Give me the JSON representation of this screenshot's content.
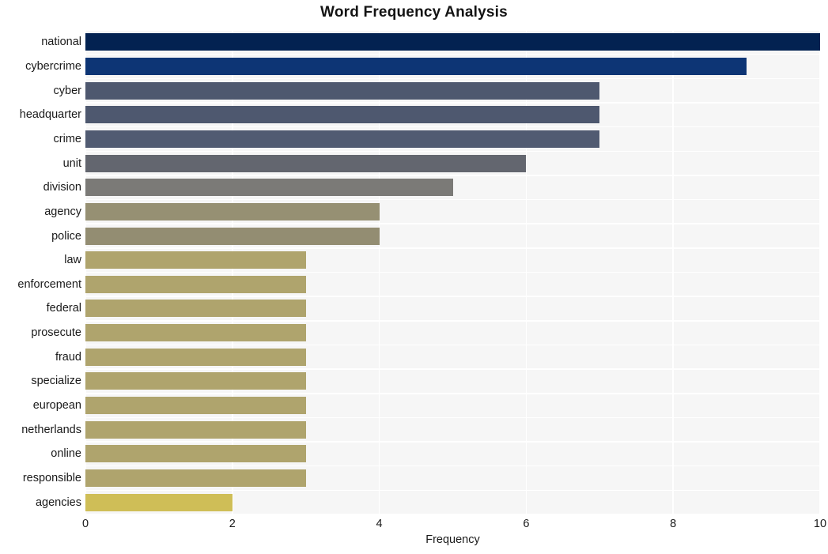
{
  "chart_data": {
    "type": "bar",
    "orientation": "horizontal",
    "title": "Word Frequency Analysis",
    "xlabel": "Frequency",
    "ylabel": "",
    "xlim": [
      0,
      10
    ],
    "xticks": [
      0,
      2,
      4,
      6,
      8,
      10
    ],
    "grid": true,
    "legend": null,
    "categories": [
      "national",
      "cybercrime",
      "cyber",
      "headquarter",
      "crime",
      "unit",
      "division",
      "agency",
      "police",
      "law",
      "enforcement",
      "federal",
      "prosecute",
      "fraud",
      "specialize",
      "european",
      "netherlands",
      "online",
      "responsible",
      "agencies"
    ],
    "values": [
      10,
      9,
      7,
      7,
      7,
      6,
      5,
      4,
      4,
      3,
      3,
      3,
      3,
      3,
      3,
      3,
      3,
      3,
      3,
      2
    ],
    "bar_colors": [
      "#032251",
      "#0d3575",
      "#4e586f",
      "#4e586f",
      "#515b72",
      "#63666f",
      "#7b7a77",
      "#969073",
      "#938d72",
      "#afa46d",
      "#afa46d",
      "#afa46d",
      "#afa46d",
      "#afa46d",
      "#afa46d",
      "#afa46d",
      "#afa46d",
      "#afa46d",
      "#afa46d",
      "#cfbe57"
    ],
    "plot_background": "#f6f6f6",
    "gridline_color": "#ffffff",
    "figure_background": "#ffffff"
  }
}
